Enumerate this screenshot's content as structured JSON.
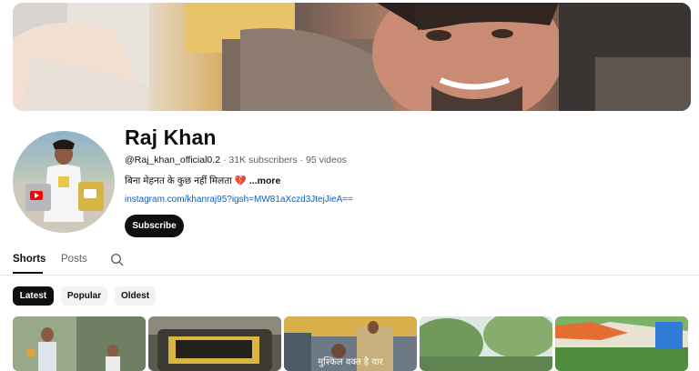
{
  "channel": {
    "name": "Raj Khan",
    "handle": "@Raj_khan_official0.2",
    "stats": " · 31K subscribers · 95 videos",
    "bio": "बिना मेहनत के कुछ नहीं मिलता",
    "bio_emoji": "💔",
    "more_label": "...more",
    "link": "instagram.com/khanraj95?igsh=MW81aXczd3JtejJieA==",
    "subscribe_label": "Subscribe"
  },
  "tabs": [
    {
      "label": "Shorts",
      "active": true
    },
    {
      "label": "Posts",
      "active": false
    }
  ],
  "chips": [
    {
      "label": "Latest",
      "active": true
    },
    {
      "label": "Popular",
      "active": false
    },
    {
      "label": "Oldest",
      "active": false
    }
  ],
  "thumbnails": [
    {
      "caption": ""
    },
    {
      "caption": ""
    },
    {
      "caption": "मुश्किल वक्त है यार"
    },
    {
      "caption": ""
    },
    {
      "caption": ""
    }
  ],
  "colors": {
    "accent_dark": "#0f0f0f",
    "link": "#065fd4",
    "secondary_text": "#606060",
    "chip_bg": "#f2f2f2"
  }
}
